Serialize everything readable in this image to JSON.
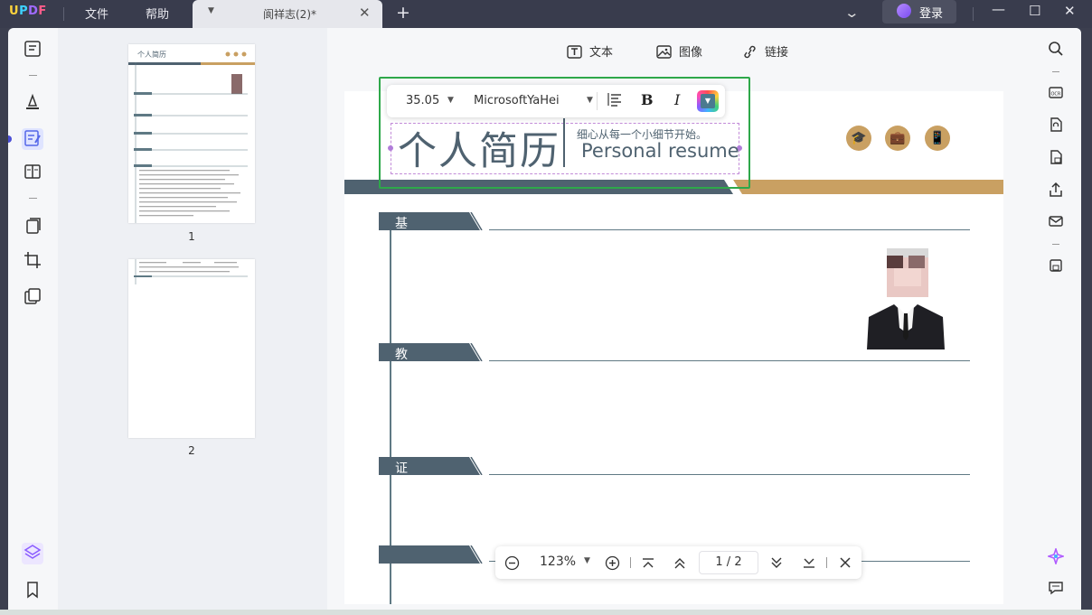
{
  "app": {
    "logo": "UPDF",
    "menu": [
      "文件",
      "帮助"
    ],
    "tab": {
      "title": "阆祥志(2)*"
    },
    "login_label": "登录"
  },
  "editbar": {
    "text": "文本",
    "image": "图像",
    "link": "链接"
  },
  "text_toolbar": {
    "font_size": "35.05",
    "font_name": "MicrosoftYaHei",
    "bold": "B",
    "italic": "I"
  },
  "resume": {
    "title": "个人简历",
    "subtitle_cn": "细心从每一个小细节开始。",
    "subtitle_en": "Personal resume",
    "sections": [
      "基本信息",
      "教育背景",
      "证书及奖励",
      ""
    ]
  },
  "thumbnails": {
    "pages": [
      "1",
      "2"
    ]
  },
  "zoom": {
    "level": "123%",
    "current_page": "1",
    "total_pages": "2"
  },
  "colors": {
    "accent": "#2ea84a",
    "header_band": "#4f6270",
    "gold": "#c9a062",
    "brand_purple": "#4b4fd6"
  }
}
